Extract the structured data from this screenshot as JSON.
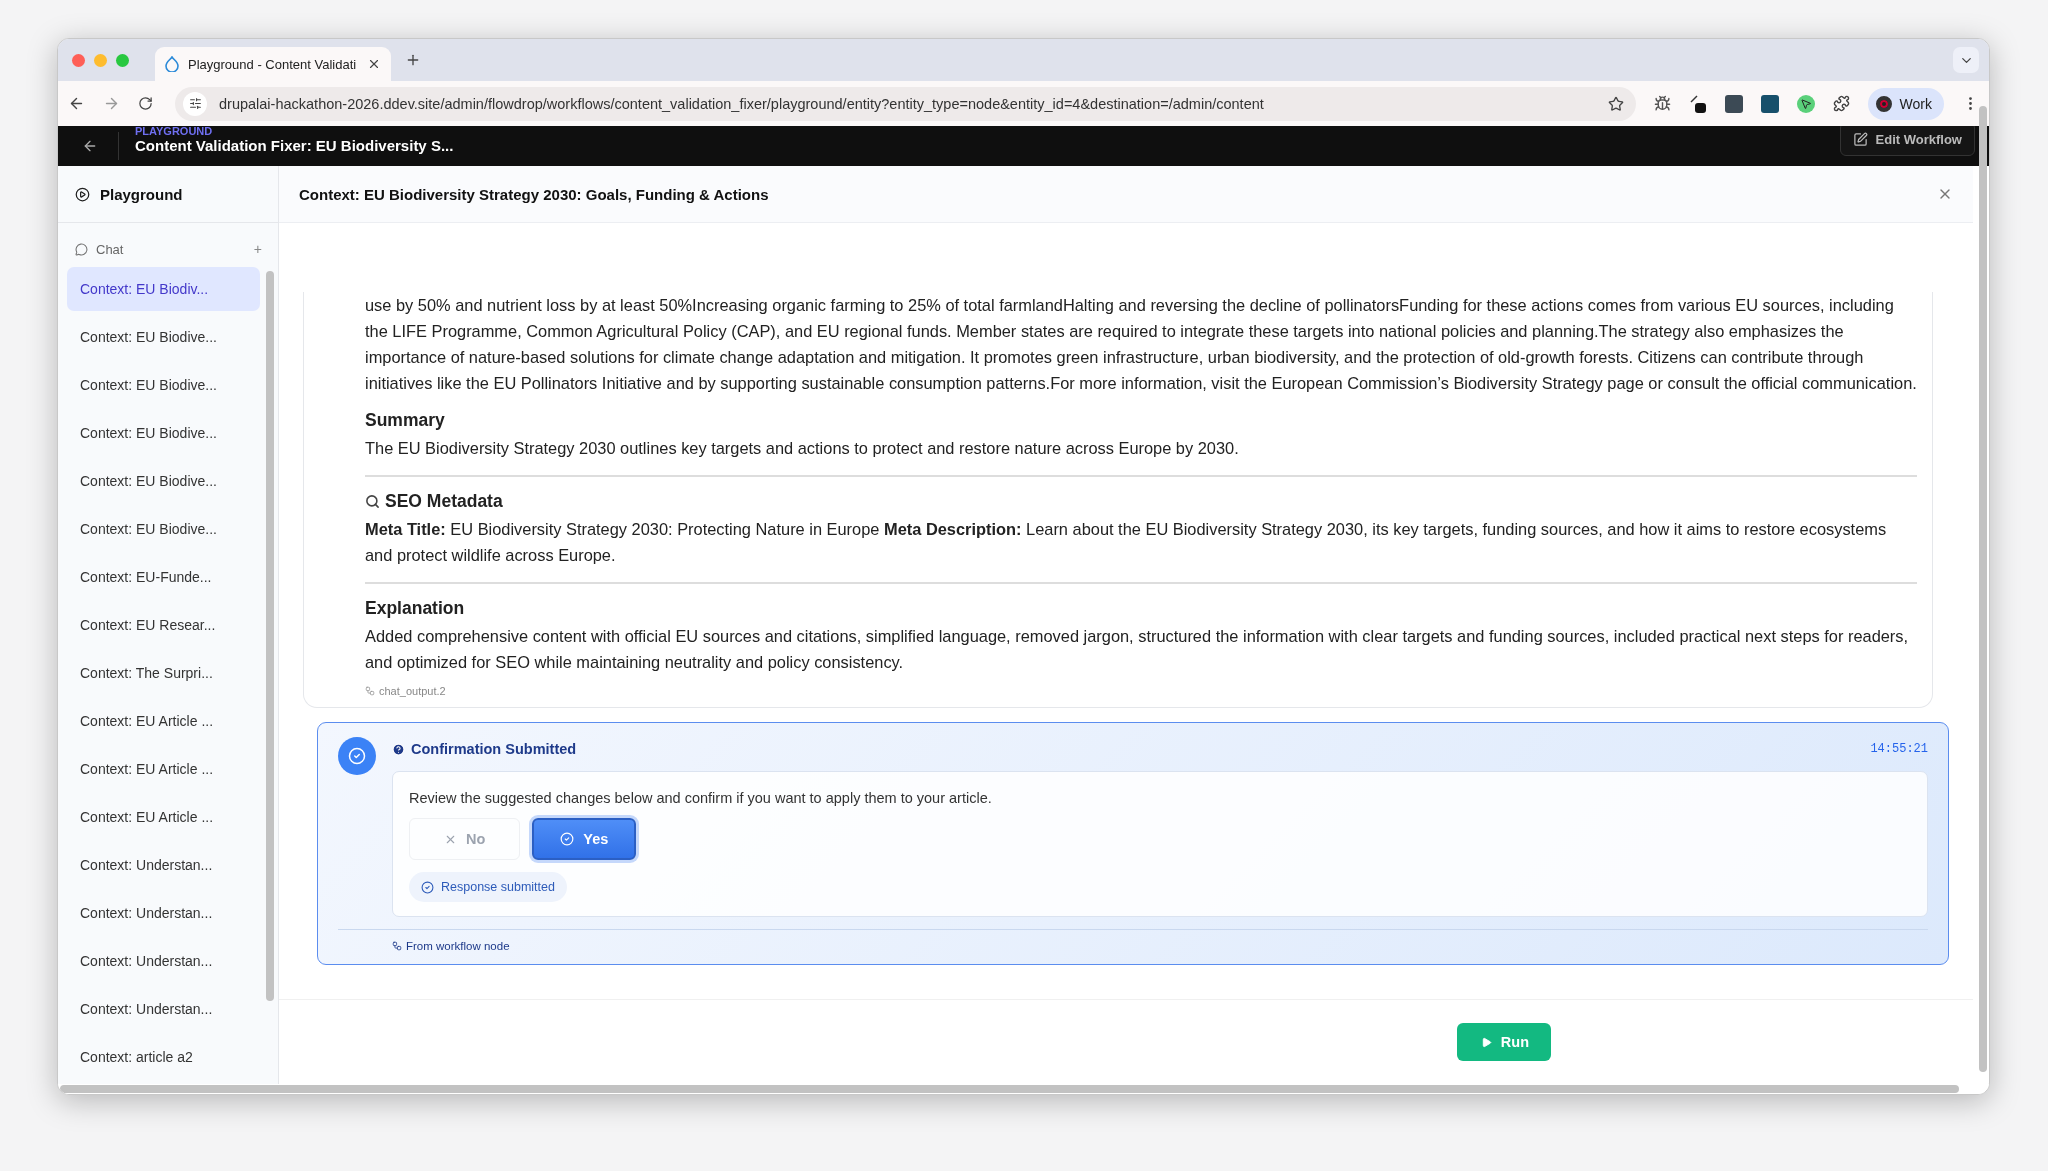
{
  "browser": {
    "tab_title": "Playground - Content Validati",
    "url": "drupalai-hackathon-2026.ddev.site/admin/flowdrop/workflows/content_validation_fixer/playground/entity?entity_type=node&entity_id=4&destination=/admin/content",
    "profile": "Work"
  },
  "app_header": {
    "eyebrow": "PLAYGROUND",
    "title": "Content Validation Fixer: EU Biodiversity S...",
    "edit_button": "Edit Workflow"
  },
  "sidebar": {
    "title": "Playground",
    "section": "Chat",
    "add": "+",
    "items": [
      {
        "label": "Context: EU Biodiv...",
        "selected": true
      },
      {
        "label": "Context: EU Biodive...",
        "selected": false
      },
      {
        "label": "Context: EU Biodive...",
        "selected": false
      },
      {
        "label": "Context: EU Biodive...",
        "selected": false
      },
      {
        "label": "Context: EU Biodive...",
        "selected": false
      },
      {
        "label": "Context: EU Biodive...",
        "selected": false
      },
      {
        "label": "Context: EU-Funde...",
        "selected": false
      },
      {
        "label": "Context: EU Resear...",
        "selected": false
      },
      {
        "label": "Context: The Surpri...",
        "selected": false
      },
      {
        "label": "Context: EU Article ...",
        "selected": false
      },
      {
        "label": "Context: EU Article ...",
        "selected": false
      },
      {
        "label": "Context: EU Article ...",
        "selected": false
      },
      {
        "label": "Context: Understan...",
        "selected": false
      },
      {
        "label": "Context: Understan...",
        "selected": false
      },
      {
        "label": "Context: Understan...",
        "selected": false
      },
      {
        "label": "Context: Understan...",
        "selected": false
      },
      {
        "label": "Context: article a2",
        "selected": false
      }
    ]
  },
  "panel": {
    "title": "Context: EU Biodiversity Strategy 2030: Goals, Funding & Actions"
  },
  "message": {
    "paragraph": "use by 50% and nutrient loss by at least 50%Increasing organic farming to 25% of total farmlandHalting and reversing the decline of pollinatorsFunding for these actions comes from various EU sources, including the LIFE Programme, Common Agricultural Policy (CAP), and EU regional funds. Member states are required to integrate these targets into national policies and planning.The strategy also emphasizes the importance of nature-based solutions for climate change adaptation and mitigation. It promotes green infrastructure, urban biodiversity, and the protection of old-growth forests. Citizens can contribute through initiatives like the EU Pollinators Initiative and by supporting sustainable consumption patterns.For more information, visit the European Commission’s Biodiversity Strategy page or consult the official communication.",
    "sections": [
      {
        "heading": "Summary",
        "icon": false,
        "divider": true,
        "text": "The EU Biodiversity Strategy 2030 outlines key targets and actions to protect and restore nature across Europe by 2030."
      },
      {
        "heading": "SEO Metadata",
        "icon": true,
        "divider": true,
        "text": "**Meta Title:** EU Biodiversity Strategy 2030: Protecting Nature in Europe **Meta Description:** Learn about the EU Biodiversity Strategy 2030, its key targets, funding sources, and how it aims to restore ecosystems and protect wildlife across Europe."
      },
      {
        "heading": "Explanation",
        "icon": false,
        "divider": false,
        "text": "Added comprehensive content with official EU sources and citations, simplified language, removed jargon, structured the information with clear targets and funding sources, included practical next steps for readers, and optimized for SEO while maintaining neutrality and policy consistency."
      }
    ],
    "source": "chat_output.2"
  },
  "confirmation": {
    "title": "Confirmation Submitted",
    "time": "14:55:21",
    "prompt": "Review the suggested changes below and confirm if you want to apply them to your article.",
    "options": [
      {
        "label": "No",
        "kind": "reject",
        "selected": false
      },
      {
        "label": "Yes",
        "kind": "accept",
        "selected": true
      }
    ],
    "status": "Response submitted",
    "footer": "From workflow node"
  },
  "run_button": "Run"
}
